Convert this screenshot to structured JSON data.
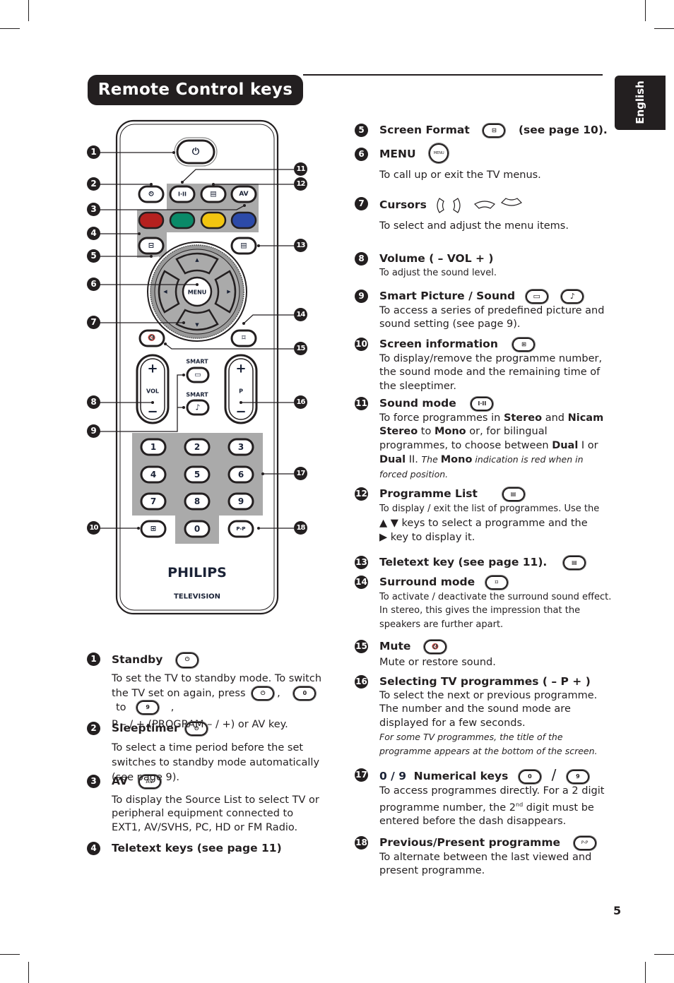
{
  "page": {
    "title": "Remote Control keys",
    "language_tab": "English",
    "page_number": "5"
  },
  "remote": {
    "keys": {
      "standby_icon": "⏻",
      "sleeptimer_icon": "⏲",
      "sound_mode": "I·II",
      "programme_list_icon": "▤",
      "av": "AV",
      "color_keys": [
        "#b5211f",
        "#0a8a68",
        "#f2c510",
        "#2c4aa8"
      ],
      "screen_format_icon": "⊟",
      "teletext_icon": "▤",
      "menu": "MENU",
      "up": "▲",
      "down": "▼",
      "left": "◀",
      "right": "▶",
      "mute_icon": "🔇",
      "surround_icon": "⌑",
      "vol_plus": "+",
      "vol_label": "VOL",
      "vol_minus": "−",
      "p_plus": "+",
      "p_label": "P",
      "p_minus": "−",
      "smart_label": "SMART",
      "smart_picture_icon": "▭",
      "smart_sound_icon": "♪",
      "digits": [
        "1",
        "2",
        "3",
        "4",
        "5",
        "6",
        "7",
        "8",
        "9"
      ],
      "zero": "0",
      "info_icon": "⊞",
      "pp": "P‹P"
    },
    "brand": "PHILIPS",
    "sub_brand": "TELEVISION",
    "callouts": [
      "1",
      "2",
      "3",
      "4",
      "5",
      "6",
      "7",
      "8",
      "9",
      "10",
      "11",
      "12",
      "13",
      "14",
      "15",
      "16",
      "17",
      "18"
    ]
  },
  "entries": {
    "e1": {
      "n": "1",
      "title": "Standby",
      "desc_a": "To set the TV to standby mode. To switch the TV set on again, press",
      "sep1": ",",
      "k0": "0",
      "to": "to",
      "k9": "9",
      "sep2": ",",
      "desc_b": "P – / + (PROGRAM – / +) or AV key."
    },
    "e2": {
      "n": "2",
      "title": "Sleeptimer",
      "desc": "To select a time period before the set switches to standby mode automatically (see page 9)."
    },
    "e3": {
      "n": "3",
      "title": "AV",
      "key": "AV",
      "desc": "To display the Source List to select TV or peripheral equipment connected to EXT1, AV/SVHS, PC, HD or FM Radio."
    },
    "e4": {
      "n": "4",
      "title": "Teletext keys (see page 11)"
    },
    "e5": {
      "n": "5",
      "title": "Screen Format",
      "suffix": "(see page 10)."
    },
    "e6": {
      "n": "6",
      "title": "MENU",
      "key": "MENU",
      "desc": "To call up or exit the TV menus."
    },
    "e7": {
      "n": "7",
      "title": "Cursors",
      "desc": "To select and adjust the menu items."
    },
    "e8": {
      "n": "8",
      "title": "Volume ( – VOL + )",
      "desc": "To adjust the sound level."
    },
    "e9": {
      "n": "9",
      "title": "Smart Picture / Sound",
      "desc": "To access a series of predefined picture and sound setting (see page 9)."
    },
    "e10": {
      "n": "10",
      "title": "Screen information",
      "desc": "To display/remove the programme number, the sound mode and the remaining time of the sleeptimer."
    },
    "e11": {
      "n": "11",
      "title": "Sound mode",
      "key": "I·II",
      "t1": "To force programmes in ",
      "b1": "Stereo",
      "t2": " and ",
      "b2": "Nicam Stereo",
      "t3": " to ",
      "b3": "Mono",
      "t4": " or, for bilingual programmes, to choose between ",
      "b4": "Dual",
      "t5": " I or ",
      "b5": "Dual",
      "t6": " II. ",
      "i1": "The ",
      "b6": "Mono",
      "i2": " indication is red when in forced position."
    },
    "e12": {
      "n": "12",
      "title": "Programme List",
      "desc1": "To display / exit the list of programmes. Use the",
      "desc2": "▲ ▼ keys to select a programme and the",
      "desc3": "▶  key to display it."
    },
    "e13": {
      "n": "13",
      "title": "Teletext key (see page 11)."
    },
    "e14": {
      "n": "14",
      "title": "Surround mode",
      "desc": "To activate / deactivate the surround sound effect. In stereo, this gives the impression that the speakers are further apart."
    },
    "e15": {
      "n": "15",
      "title": "Mute",
      "desc": "Mute or restore sound."
    },
    "e16": {
      "n": "16",
      "title": "Selecting TV programmes  ( – P + )",
      "desc": "To select the next or previous programme. The number and the sound mode are displayed for a few seconds.",
      "note": "For some TV programmes, the title of the programme appears at the bottom of the screen."
    },
    "e17": {
      "n": "17",
      "prefix": "0 / 9",
      "title": "Numerical keys",
      "k0": "0",
      "slash": "/",
      "k9": "9",
      "desc_a": "To access programmes directly. For a 2 digit programme number, the 2",
      "sup": "nd",
      "desc_b": " digit must be entered before the dash disappears."
    },
    "e18": {
      "n": "18",
      "title": "Previous/Present programme",
      "key": "P‹P",
      "desc": "To alternate between the last viewed and present programme."
    }
  }
}
